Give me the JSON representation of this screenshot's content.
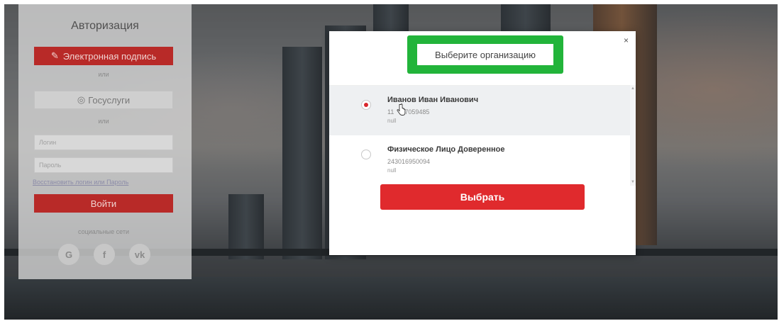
{
  "login": {
    "title": "Авторизация",
    "esign_label": "Электронная подпись",
    "or_1": "или",
    "gosuslugi_label": "Госуслуги",
    "or_2": "или",
    "login_placeholder": "Логин",
    "password_placeholder": "Пароль",
    "restore_link": "Восстановить логин или Пароль",
    "submit_label": "Войти",
    "social_label": "социальные сети",
    "social": [
      {
        "icon": "google-icon",
        "glyph": "G"
      },
      {
        "icon": "facebook-icon",
        "glyph": "f"
      },
      {
        "icon": "vk-icon",
        "glyph": "vk"
      }
    ]
  },
  "modal": {
    "close_glyph": "×",
    "title": "Выберите организацию",
    "highlight_color": "#22b43a",
    "organizations": [
      {
        "name": "Иванов Иван Иванович",
        "inn": "11    27059485",
        "extra": "null",
        "selected": true
      },
      {
        "name": "Физическое Лицо Доверенное",
        "inn": "243016950094",
        "extra": "null",
        "selected": false
      }
    ],
    "choose_label": "Выбрать"
  },
  "colors": {
    "accent_red": "#e02a2d",
    "dim_red": "#b82a28"
  }
}
